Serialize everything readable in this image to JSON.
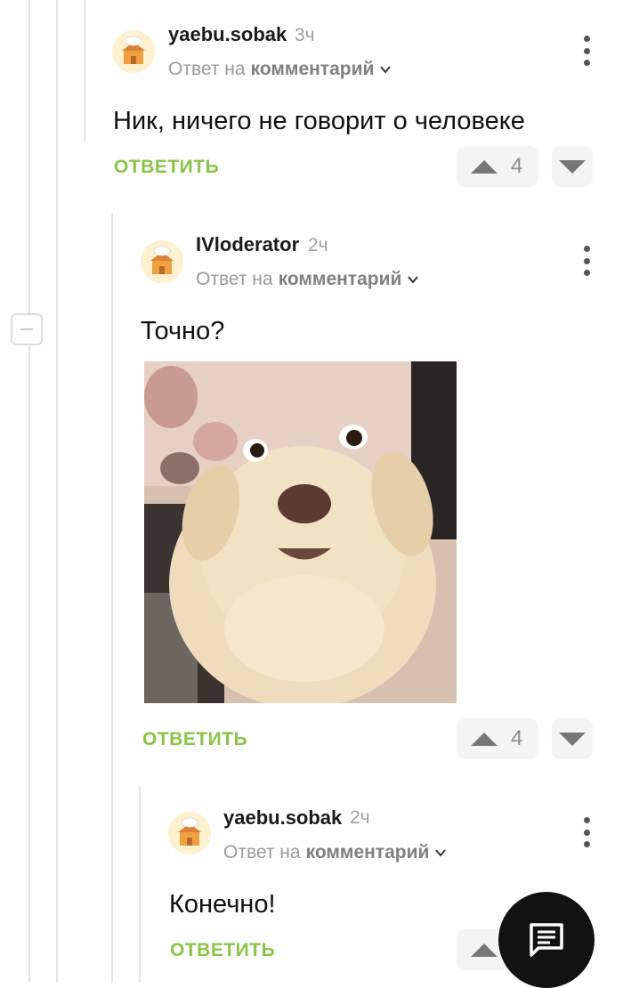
{
  "comments": [
    {
      "username": "yaebu.sobak",
      "time": "3ч",
      "reply_prefix": "Ответ на",
      "reply_link": "комментарий",
      "text": "Ник, ничего не говорит о человеке",
      "reply_label": "ОТВЕТИТЬ",
      "votes": "4"
    },
    {
      "username": "IVloderator",
      "time": "2ч",
      "reply_prefix": "Ответ на",
      "reply_link": "комментарий",
      "text": "Точно?",
      "reply_label": "ОТВЕТИТЬ",
      "votes": "4",
      "image": "surprised-labrador-photo"
    },
    {
      "username": "yaebu.sobak",
      "time": "2ч",
      "reply_prefix": "Ответ на",
      "reply_link": "комментарий",
      "text": "Конечно!",
      "reply_label": "ОТВЕТИТЬ"
    }
  ],
  "icons": {
    "avatar": "chef-hat-house-avatar",
    "more": "vertical-dots-icon",
    "collapse": "minus-collapse-icon",
    "fab": "comment-icon"
  },
  "colors": {
    "reply_green": "#8bc34a",
    "fab_bg": "#121212"
  }
}
